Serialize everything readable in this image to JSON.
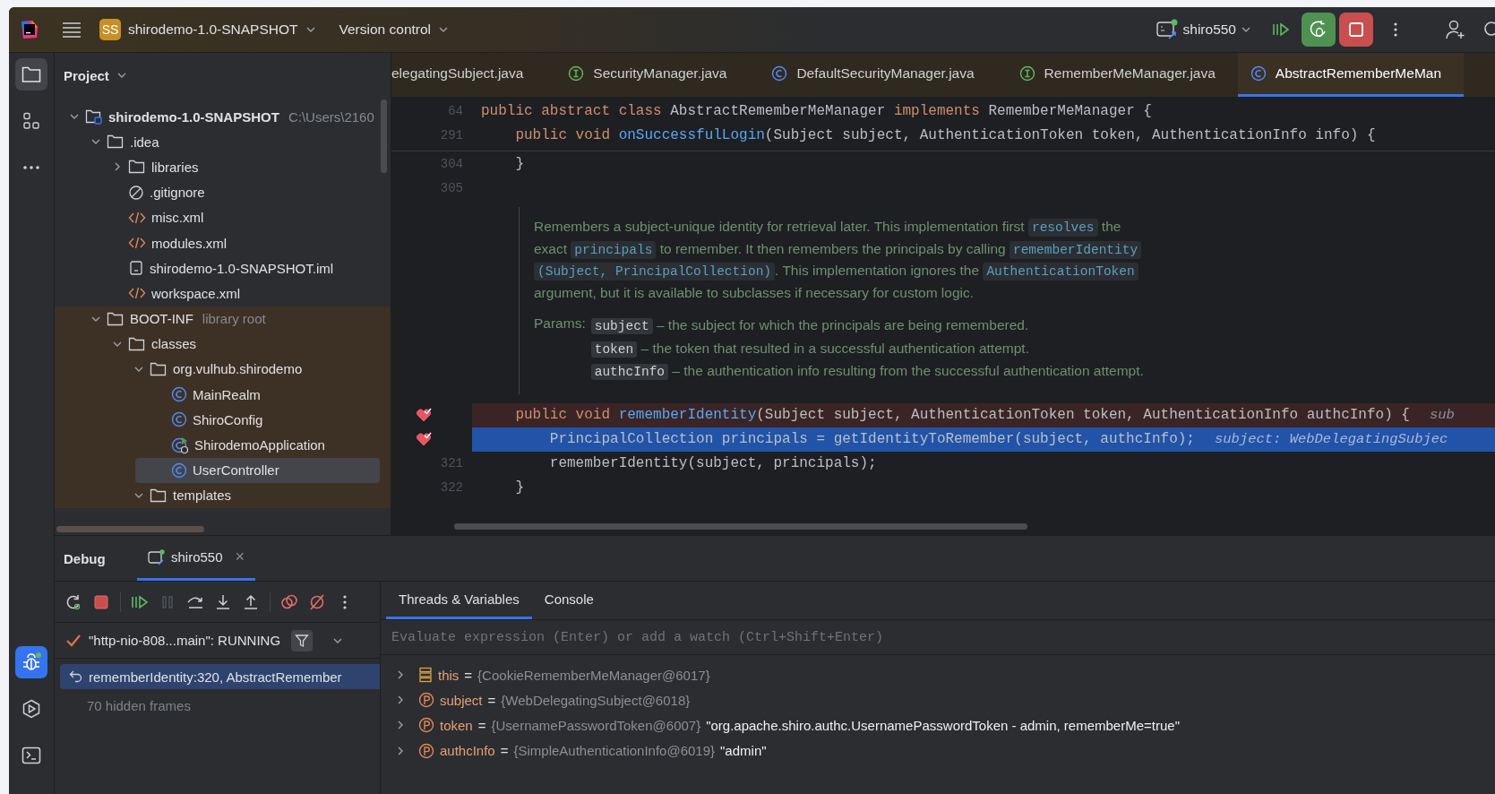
{
  "title_bar": {
    "project_badge": "SS",
    "project": "shirodemo-1.0-SNAPSHOT",
    "vcs": "Version control",
    "run_config": "shiro550"
  },
  "tool_strip": [
    {
      "kind": "project",
      "selected": true
    },
    {
      "kind": "structure",
      "selected": false
    },
    {
      "kind": "more",
      "selected": false
    },
    {
      "kind": "debug",
      "selected": true
    },
    {
      "kind": "services",
      "selected": false
    },
    {
      "kind": "terminal",
      "selected": false
    }
  ],
  "project_panel": {
    "title": "Project",
    "tree": [
      {
        "name": "shirodemo-1.0-SNAPSHOT",
        "hint": "C:\\Users\\2160",
        "kind": "module",
        "expanded": true,
        "selected": false,
        "children": [
          {
            "name": ".idea",
            "kind": "folder",
            "expanded": true,
            "selected": false,
            "children": [
              {
                "name": "libraries",
                "kind": "folder",
                "expanded": false,
                "selected": false
              },
              {
                "name": ".gitignore",
                "kind": "ignore",
                "selected": false
              },
              {
                "name": "misc.xml",
                "kind": "xml",
                "selected": false
              },
              {
                "name": "modules.xml",
                "kind": "xml",
                "selected": false
              },
              {
                "name": "shirodemo-1.0-SNAPSHOT.iml",
                "kind": "iml",
                "selected": false
              },
              {
                "name": "workspace.xml",
                "kind": "xml",
                "selected": false
              }
            ]
          },
          {
            "name": "BOOT-INF",
            "hint": "library root",
            "kind": "folder",
            "library_root": true,
            "expanded": true,
            "selected": false,
            "children": [
              {
                "name": "classes",
                "kind": "folder",
                "expanded": true,
                "selected": false,
                "children": [
                  {
                    "name": "org.vulhub.shirodemo",
                    "kind": "folder",
                    "expanded": true,
                    "selected": false,
                    "children": [
                      {
                        "name": "MainRealm",
                        "kind": "class",
                        "selected": false
                      },
                      {
                        "name": "ShiroConfig",
                        "kind": "class",
                        "selected": false
                      },
                      {
                        "name": "ShirodemoApplication",
                        "kind": "app-class",
                        "selected": false
                      },
                      {
                        "name": "UserController",
                        "kind": "class",
                        "selected": true
                      }
                    ]
                  },
                  {
                    "name": "templates",
                    "kind": "folder",
                    "expanded": true,
                    "selected": false
                  }
                ]
              }
            ]
          }
        ]
      }
    ]
  },
  "editor": {
    "tabs": [
      {
        "label": "elegatingSubject.java",
        "kind": "none",
        "selected": false
      },
      {
        "label": "SecurityManager.java",
        "kind": "interface",
        "selected": false
      },
      {
        "label": "DefaultSecurityManager.java",
        "kind": "class",
        "selected": false
      },
      {
        "label": "RememberMeManager.java",
        "kind": "interface",
        "selected": false
      },
      {
        "label": "AbstractRememberMeMan",
        "kind": "class",
        "selected": true
      }
    ],
    "lines": [
      {
        "kind": "code",
        "sticky": true,
        "number": "64",
        "segments": [
          {
            "text": "public abstract class ",
            "kind": "keyword"
          },
          {
            "text": "AbstractRememberMeManager ",
            "kind": "plain"
          },
          {
            "text": "implements ",
            "kind": "keyword"
          },
          {
            "text": "RememberMeManager {",
            "kind": "plain"
          }
        ]
      },
      {
        "kind": "code",
        "sticky": true,
        "number": "291",
        "segments": [
          {
            "text": "    public void ",
            "kind": "keyword"
          },
          {
            "text": "onSuccessfulLogin",
            "kind": "method"
          },
          {
            "text": "(Subject subject, AuthenticationToken token, AuthenticationInfo info) {",
            "kind": "plain"
          }
        ]
      },
      {
        "kind": "code",
        "number": "304",
        "segments": [
          {
            "text": "    }",
            "kind": "plain"
          }
        ]
      },
      {
        "kind": "code",
        "number": "305"
      },
      {
        "kind": "doc",
        "paragraph": [
          {
            "text": "Remembers a subject-unique identity for retrieval later. This implementation first ",
            "kind": "text"
          },
          {
            "text": "resolves",
            "kind": "link"
          },
          {
            "text": " the exact ",
            "kind": "text"
          },
          {
            "text": "principals",
            "kind": "link"
          },
          {
            "text": " to remember. It then remembers the principals by calling ",
            "kind": "text"
          },
          {
            "text": "rememberIdentity",
            "kind": "link"
          },
          {
            "text": "(Subject, PrincipalCollection)",
            "kind": "link"
          },
          {
            "text": ". This implementation ignores the ",
            "kind": "text"
          },
          {
            "text": "AuthenticationToken",
            "kind": "link"
          },
          {
            "text": " argument, but it is available to subclasses if necessary for custom logic.",
            "kind": "text"
          }
        ],
        "params_label": "Params:",
        "params": [
          {
            "name": "subject",
            "desc": "– the subject for which the principals are being remembered."
          },
          {
            "name": "token",
            "desc": "– the token that resulted in a successful authentication attempt."
          },
          {
            "name": "authcInfo",
            "desc": "– the authentication info resulting from the successful authentication attempt."
          }
        ]
      },
      {
        "kind": "code",
        "breakpoint": true,
        "current": false,
        "segments": [
          {
            "text": "    public void ",
            "kind": "keyword"
          },
          {
            "text": "rememberIdentity",
            "kind": "method"
          },
          {
            "text": "(Subject subject, AuthenticationToken token, AuthenticationInfo authcInfo) {",
            "kind": "plain"
          }
        ],
        "hint": "sub"
      },
      {
        "kind": "code",
        "breakpoint": true,
        "current": true,
        "segments": [
          {
            "text": "        PrincipalCollection principals = getIdentityToRemember(subject, authcInfo);",
            "kind": "plain"
          }
        ],
        "hint": "subject: WebDelegatingSubjec"
      },
      {
        "kind": "code",
        "number": "321",
        "segments": [
          {
            "text": "        rememberIdentity(subject, principals);",
            "kind": "plain"
          }
        ]
      },
      {
        "kind": "code",
        "number": "322",
        "segments": [
          {
            "text": "    }",
            "kind": "plain"
          }
        ]
      }
    ]
  },
  "debug": {
    "title": "Debug",
    "session": {
      "label": "shiro550",
      "selected": true,
      "close": "×"
    },
    "toolbar": [
      {
        "kind": "rerun",
        "disabled": false
      },
      {
        "kind": "stop",
        "disabled": false
      },
      {
        "kind": "separator"
      },
      {
        "kind": "resume",
        "disabled": false
      },
      {
        "kind": "pause",
        "disabled": true
      },
      {
        "kind": "step-over",
        "disabled": false
      },
      {
        "kind": "step-into",
        "disabled": false
      },
      {
        "kind": "step-out",
        "disabled": false
      },
      {
        "kind": "separator"
      },
      {
        "kind": "breakpoints",
        "disabled": false
      },
      {
        "kind": "mute",
        "disabled": false
      },
      {
        "kind": "more",
        "disabled": false
      }
    ],
    "tabs": [
      {
        "label": "Threads & Variables",
        "selected": true
      },
      {
        "label": "Console",
        "selected": false
      }
    ],
    "thread": "\"http-nio-808...main\": RUNNING",
    "frames": [
      {
        "label": "rememberIdentity:320, AbstractRemember",
        "selected": true
      }
    ],
    "hidden_frames": "70 hidden frames",
    "eval_placeholder": "Evaluate expression (Enter) or add a watch (Ctrl+Shift+Enter)",
    "variables": [
      {
        "kind": "this",
        "name": "this",
        "op": "=",
        "value": "{CookieRememberMeManager@6017}"
      },
      {
        "kind": "param",
        "name": "subject",
        "op": "=",
        "value": "{WebDelegatingSubject@6018}"
      },
      {
        "kind": "param",
        "name": "token",
        "op": "=",
        "value": "{UsernamePasswordToken@6007}",
        "string": "\"org.apache.shiro.authc.UsernamePasswordToken - admin, rememberMe=true\""
      },
      {
        "kind": "param",
        "name": "authcInfo",
        "op": "=",
        "value": "{SimpleAuthenticationInfo@6019}",
        "string": "\"admin\""
      }
    ]
  }
}
